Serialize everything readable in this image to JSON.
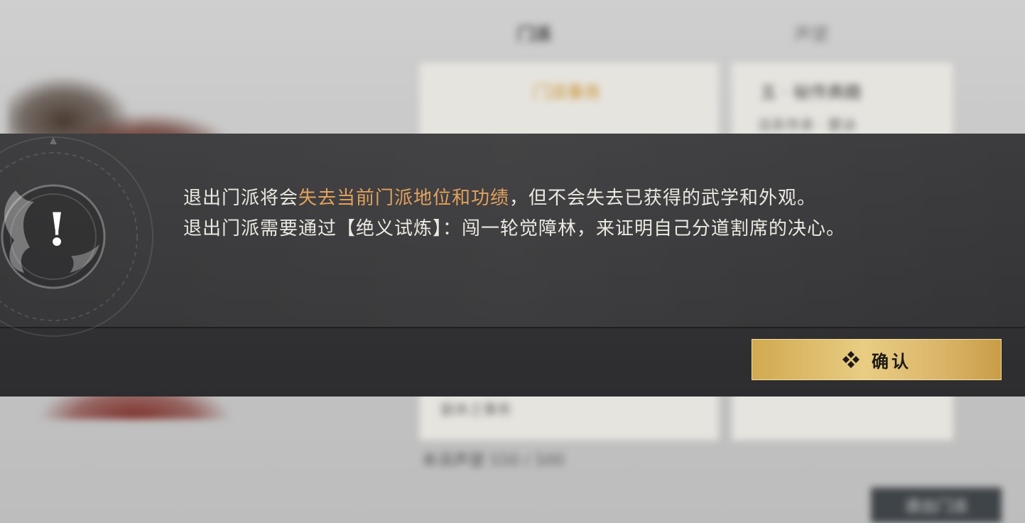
{
  "background": {
    "tabs": [
      "门派",
      "声望"
    ],
    "left_card_title": "门派事务",
    "left_card_line": "副本之事务",
    "right_card_title": "五 · 秘传典籍",
    "right_card_line": "派系传承 · 要诀",
    "footer_text": "本派声望 550 / 500",
    "action_button": "退出门派"
  },
  "dialog": {
    "alert_symbol": "!",
    "line1_prefix": "退出门派将会",
    "line1_highlight": "失去当前门派地位和功绩",
    "line1_suffix": "，但不会失去已获得的武学和外观。",
    "line2": "退出门派需要通过【绝义试炼】：闯一轮觉障林，来证明自己分道割席的决心。",
    "confirm_label": "确认",
    "highlight_color": "#e2a25b"
  }
}
